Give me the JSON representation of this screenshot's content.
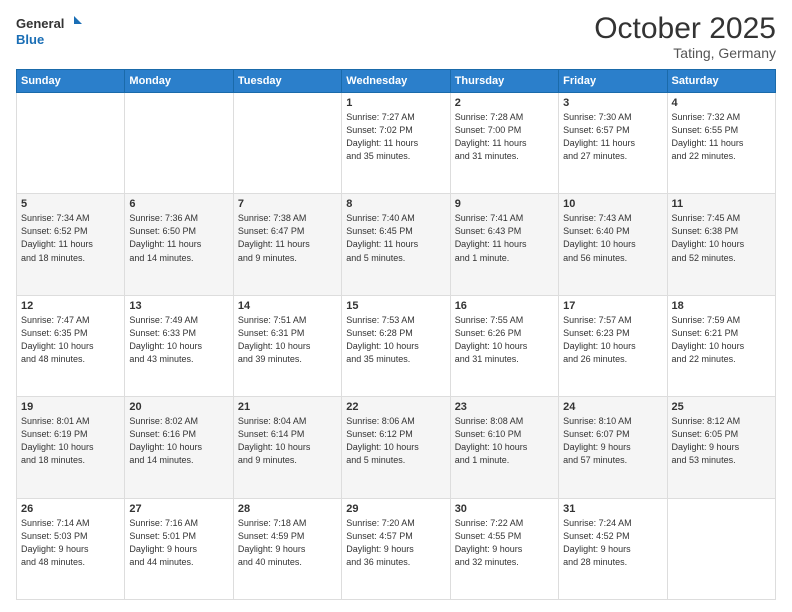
{
  "header": {
    "logo_line1": "General",
    "logo_line2": "Blue",
    "month": "October 2025",
    "location": "Tating, Germany"
  },
  "weekdays": [
    "Sunday",
    "Monday",
    "Tuesday",
    "Wednesday",
    "Thursday",
    "Friday",
    "Saturday"
  ],
  "weeks": [
    [
      {
        "day": "",
        "info": ""
      },
      {
        "day": "",
        "info": ""
      },
      {
        "day": "",
        "info": ""
      },
      {
        "day": "1",
        "info": "Sunrise: 7:27 AM\nSunset: 7:02 PM\nDaylight: 11 hours\nand 35 minutes."
      },
      {
        "day": "2",
        "info": "Sunrise: 7:28 AM\nSunset: 7:00 PM\nDaylight: 11 hours\nand 31 minutes."
      },
      {
        "day": "3",
        "info": "Sunrise: 7:30 AM\nSunset: 6:57 PM\nDaylight: 11 hours\nand 27 minutes."
      },
      {
        "day": "4",
        "info": "Sunrise: 7:32 AM\nSunset: 6:55 PM\nDaylight: 11 hours\nand 22 minutes."
      }
    ],
    [
      {
        "day": "5",
        "info": "Sunrise: 7:34 AM\nSunset: 6:52 PM\nDaylight: 11 hours\nand 18 minutes."
      },
      {
        "day": "6",
        "info": "Sunrise: 7:36 AM\nSunset: 6:50 PM\nDaylight: 11 hours\nand 14 minutes."
      },
      {
        "day": "7",
        "info": "Sunrise: 7:38 AM\nSunset: 6:47 PM\nDaylight: 11 hours\nand 9 minutes."
      },
      {
        "day": "8",
        "info": "Sunrise: 7:40 AM\nSunset: 6:45 PM\nDaylight: 11 hours\nand 5 minutes."
      },
      {
        "day": "9",
        "info": "Sunrise: 7:41 AM\nSunset: 6:43 PM\nDaylight: 11 hours\nand 1 minute."
      },
      {
        "day": "10",
        "info": "Sunrise: 7:43 AM\nSunset: 6:40 PM\nDaylight: 10 hours\nand 56 minutes."
      },
      {
        "day": "11",
        "info": "Sunrise: 7:45 AM\nSunset: 6:38 PM\nDaylight: 10 hours\nand 52 minutes."
      }
    ],
    [
      {
        "day": "12",
        "info": "Sunrise: 7:47 AM\nSunset: 6:35 PM\nDaylight: 10 hours\nand 48 minutes."
      },
      {
        "day": "13",
        "info": "Sunrise: 7:49 AM\nSunset: 6:33 PM\nDaylight: 10 hours\nand 43 minutes."
      },
      {
        "day": "14",
        "info": "Sunrise: 7:51 AM\nSunset: 6:31 PM\nDaylight: 10 hours\nand 39 minutes."
      },
      {
        "day": "15",
        "info": "Sunrise: 7:53 AM\nSunset: 6:28 PM\nDaylight: 10 hours\nand 35 minutes."
      },
      {
        "day": "16",
        "info": "Sunrise: 7:55 AM\nSunset: 6:26 PM\nDaylight: 10 hours\nand 31 minutes."
      },
      {
        "day": "17",
        "info": "Sunrise: 7:57 AM\nSunset: 6:23 PM\nDaylight: 10 hours\nand 26 minutes."
      },
      {
        "day": "18",
        "info": "Sunrise: 7:59 AM\nSunset: 6:21 PM\nDaylight: 10 hours\nand 22 minutes."
      }
    ],
    [
      {
        "day": "19",
        "info": "Sunrise: 8:01 AM\nSunset: 6:19 PM\nDaylight: 10 hours\nand 18 minutes."
      },
      {
        "day": "20",
        "info": "Sunrise: 8:02 AM\nSunset: 6:16 PM\nDaylight: 10 hours\nand 14 minutes."
      },
      {
        "day": "21",
        "info": "Sunrise: 8:04 AM\nSunset: 6:14 PM\nDaylight: 10 hours\nand 9 minutes."
      },
      {
        "day": "22",
        "info": "Sunrise: 8:06 AM\nSunset: 6:12 PM\nDaylight: 10 hours\nand 5 minutes."
      },
      {
        "day": "23",
        "info": "Sunrise: 8:08 AM\nSunset: 6:10 PM\nDaylight: 10 hours\nand 1 minute."
      },
      {
        "day": "24",
        "info": "Sunrise: 8:10 AM\nSunset: 6:07 PM\nDaylight: 9 hours\nand 57 minutes."
      },
      {
        "day": "25",
        "info": "Sunrise: 8:12 AM\nSunset: 6:05 PM\nDaylight: 9 hours\nand 53 minutes."
      }
    ],
    [
      {
        "day": "26",
        "info": "Sunrise: 7:14 AM\nSunset: 5:03 PM\nDaylight: 9 hours\nand 48 minutes."
      },
      {
        "day": "27",
        "info": "Sunrise: 7:16 AM\nSunset: 5:01 PM\nDaylight: 9 hours\nand 44 minutes."
      },
      {
        "day": "28",
        "info": "Sunrise: 7:18 AM\nSunset: 4:59 PM\nDaylight: 9 hours\nand 40 minutes."
      },
      {
        "day": "29",
        "info": "Sunrise: 7:20 AM\nSunset: 4:57 PM\nDaylight: 9 hours\nand 36 minutes."
      },
      {
        "day": "30",
        "info": "Sunrise: 7:22 AM\nSunset: 4:55 PM\nDaylight: 9 hours\nand 32 minutes."
      },
      {
        "day": "31",
        "info": "Sunrise: 7:24 AM\nSunset: 4:52 PM\nDaylight: 9 hours\nand 28 minutes."
      },
      {
        "day": "",
        "info": ""
      }
    ]
  ]
}
